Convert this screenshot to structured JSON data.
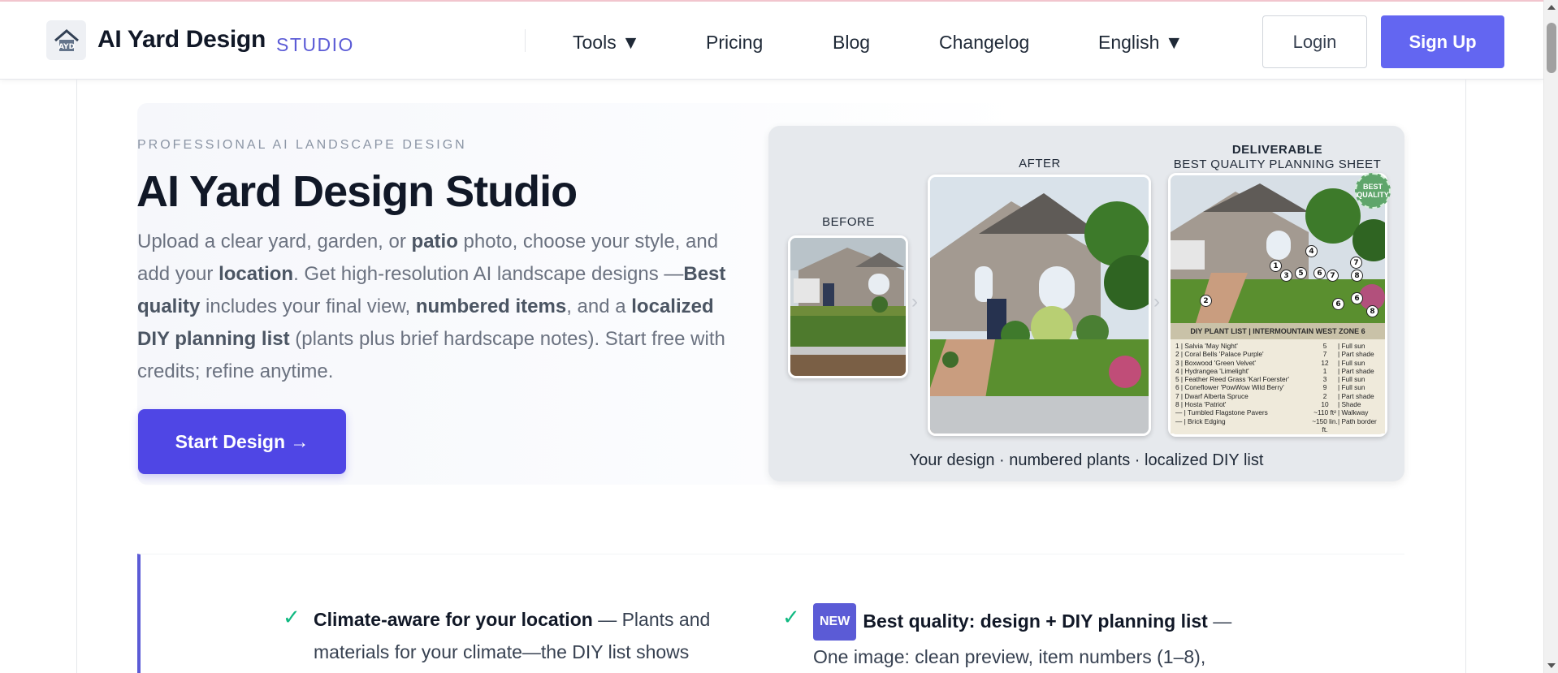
{
  "brand": {
    "name": "AI Yard Design",
    "sub": "STUDIO",
    "logo_icon": "house-logo-icon"
  },
  "nav": {
    "tools": "Tools ▼",
    "pricing": "Pricing",
    "blog": "Blog",
    "changelog": "Changelog",
    "language": "English ▼",
    "login": "Login",
    "signup": "Sign Up"
  },
  "hero": {
    "eyebrow": "PROFESSIONAL AI LANDSCAPE DESIGN",
    "title": "AI Yard Design Studio",
    "desc": {
      "p1": "Upload a clear yard, garden, or ",
      "b1": "patio",
      "p2": " photo, choose your style, and add your ",
      "b2": "location",
      "p3": ". Get high-resolution AI landscape designs —",
      "b3": "Best quality",
      "p4": " includes your final view, ",
      "b4": "numbered items",
      "p5": ", and a ",
      "b5": "localized DIY planning list",
      "p6": " (plants plus brief hardscape notes). Start free with credits; refine anytime."
    },
    "cta": "Start Design →"
  },
  "preview": {
    "before_label": "BEFORE",
    "after_label": "AFTER",
    "deliverable_label": "DELIVERABLE",
    "deliverable_sub": "BEST QUALITY PLANNING SHEET",
    "badge_line1": "BEST",
    "badge_line2": "QUALITY",
    "plan_title": "DIY PLANT LIST | INTERMOUNTAIN WEST ZONE 6",
    "plan_rows": [
      {
        "item": "1 | Salvia 'May Night'",
        "qty": "5",
        "light": "| Full sun"
      },
      {
        "item": "2 | Coral Bells 'Palace Purple'",
        "qty": "7",
        "light": "| Part shade"
      },
      {
        "item": "3 | Boxwood 'Green Velvet'",
        "qty": "12",
        "light": "| Full sun"
      },
      {
        "item": "4 | Hydrangea 'Limelight'",
        "qty": "1",
        "light": "| Part shade"
      },
      {
        "item": "5 | Feather Reed Grass 'Karl Foerster'",
        "qty": "3",
        "light": "| Full sun"
      },
      {
        "item": "6 | Coneflower 'PowWow Wild Berry'",
        "qty": "9",
        "light": "| Full sun"
      },
      {
        "item": "7 | Dwarf Alberta Spruce",
        "qty": "2",
        "light": "| Part shade"
      },
      {
        "item": "8 | Hosta 'Patriot'",
        "qty": "10",
        "light": "| Shade"
      },
      {
        "item": "— | Tumbled Flagstone Pavers",
        "qty": "~110 ft²",
        "light": "| Walkway"
      },
      {
        "item": "— | Brick Edging",
        "qty": "~150 lin. ft.",
        "light": "| Path border"
      }
    ],
    "markers": [
      "1",
      "2",
      "3",
      "4",
      "5",
      "6",
      "7",
      "8",
      "6",
      "7",
      "8"
    ],
    "caption": "Your design · numbered plants · localized DIY list"
  },
  "features": {
    "f1_title": "Climate-aware for your location",
    "f1_text": " — Plants and materials for your climate—the DIY list shows",
    "f2_badge": "NEW",
    "f2_title": "Best quality: design + DIY planning list",
    "f2_text": " — One image: clean preview, item numbers (1–8),"
  },
  "colors": {
    "accent": "#6366f1",
    "cta": "#4f46e5",
    "check": "#10b981"
  }
}
